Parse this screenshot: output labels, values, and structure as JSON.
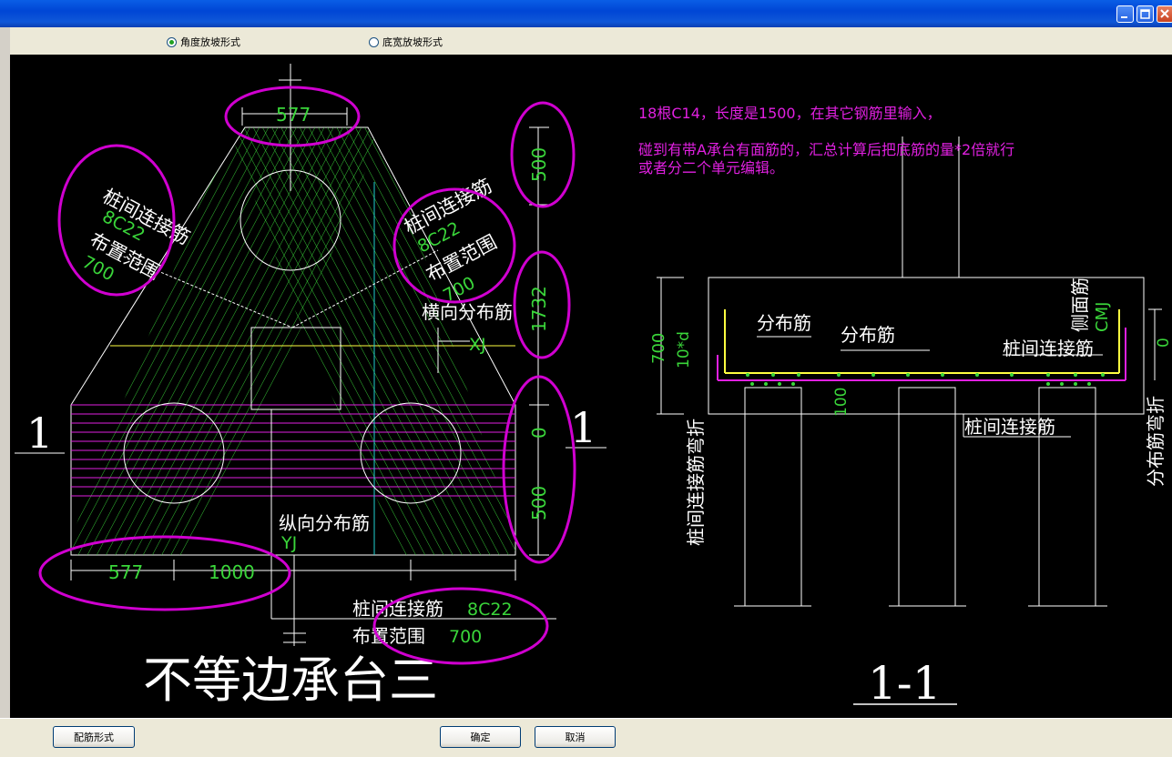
{
  "options": {
    "angle_label": "角度放坡形式",
    "width_label": "底宽放坡形式",
    "angle_selected": true
  },
  "buttons": {
    "rebar_form": "配筋形式",
    "ok": "确定",
    "cancel": "取消"
  },
  "plan": {
    "title": "不等边承台三",
    "section_mark": "1",
    "dim_top": "577",
    "dim_bottom_left": "577",
    "dim_bottom_mid": "1000",
    "dim_right_1": "500",
    "dim_right_2": "1732",
    "dim_right_3": "0",
    "dim_right_4": "500",
    "left_label_1": "桩间连接筋",
    "left_spec_1": "8C22",
    "left_label_2": "布置范围",
    "left_range_1": "700",
    "right_label_1": "桩间连接筋",
    "right_spec_1": "8C22",
    "right_label_2": "布置范围",
    "right_range_1": "700",
    "transverse_label": "横向分布筋",
    "transverse_code": "XJ",
    "longitudinal_label": "纵向分布筋",
    "longitudinal_code": "YJ",
    "bottom_label_1": "桩间连接筋",
    "bottom_spec": "8C22",
    "bottom_label_2": "布置范围",
    "bottom_range": "700"
  },
  "section": {
    "title": "1-1",
    "note_1": "18根C14，长度是1500，在其它钢筋里输入，",
    "note_2": "碰到有带A承台有面筋的，汇总计算后把底筋的量*2倍就行",
    "note_3": "或者分二个单元编辑。",
    "dist_bar_1": "分布筋",
    "dist_bar_2": "分布筋",
    "side_bar": "侧面筋",
    "side_code": "CMJ",
    "pile_bar": "桩间连接筋",
    "pile_bar_bottom": "桩间连接筋",
    "dim_700": "700",
    "dim_10d": "10*d",
    "dim_100": "100",
    "dim_0": "0",
    "left_vertical": "桩间连接筋弯折",
    "right_vertical": "分布筋弯折"
  }
}
